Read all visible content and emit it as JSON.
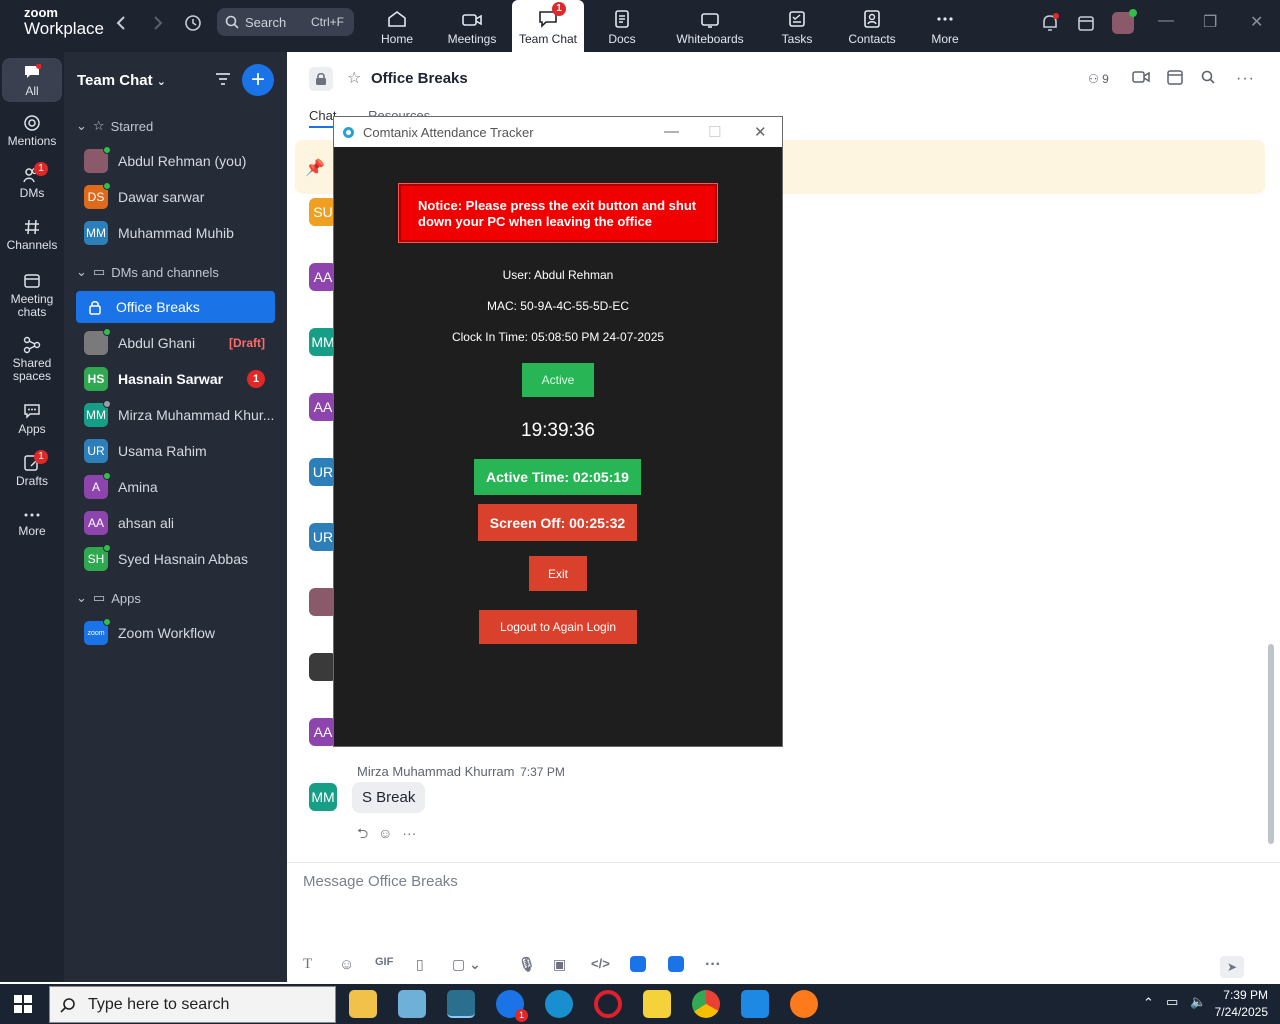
{
  "app": {
    "logo_top": "zoom",
    "logo_bottom": "Workplace"
  },
  "search": {
    "label": "Search",
    "shortcut": "Ctrl+F"
  },
  "nav_tabs": [
    {
      "label": "Home"
    },
    {
      "label": "Meetings"
    },
    {
      "label": "Team Chat",
      "badge": "1"
    },
    {
      "label": "Docs"
    },
    {
      "label": "Whiteboards"
    },
    {
      "label": "Tasks"
    },
    {
      "label": "Contacts"
    },
    {
      "label": "More"
    }
  ],
  "rail": [
    {
      "label": "All"
    },
    {
      "label": "Mentions"
    },
    {
      "label": "DMs",
      "badge": "1"
    },
    {
      "label": "Channels"
    },
    {
      "label": "Meeting chats"
    },
    {
      "label": "Shared spaces"
    },
    {
      "label": "Apps"
    },
    {
      "label": "Drafts",
      "badge": "1"
    },
    {
      "label": "More"
    }
  ],
  "sidebar": {
    "title": "Team Chat",
    "sections": {
      "starred": "Starred",
      "dms": "DMs and channels",
      "apps": "Apps"
    },
    "starred": [
      {
        "initials": "",
        "name": "Abdul Rehman (you)",
        "color": "#8a5a6a"
      },
      {
        "initials": "DS",
        "name": "Dawar sarwar",
        "color": "#e06a1b"
      },
      {
        "initials": "MM",
        "name": "Muhammad Muhib",
        "color": "#2c7fb8"
      }
    ],
    "dms": [
      {
        "initials": "",
        "name": "Office Breaks",
        "selected": true,
        "color": ""
      },
      {
        "initials": "",
        "name": "Abdul Ghani",
        "draft": "[Draft]",
        "color": "#7a7a7a"
      },
      {
        "initials": "HS",
        "name": "Hasnain Sarwar",
        "badge": "1",
        "color": "#2fa84f"
      },
      {
        "initials": "MM",
        "name": "Mirza Muhammad Khur...",
        "color": "#169e86"
      },
      {
        "initials": "UR",
        "name": "Usama Rahim",
        "color": "#2c7fb8"
      },
      {
        "initials": "A",
        "name": "Amina",
        "color": "#8e44ad"
      },
      {
        "initials": "AA",
        "name": "ahsan ali",
        "color": "#8e44ad"
      },
      {
        "initials": "SH",
        "name": "Syed Hasnain Abbas",
        "color": "#2fa84f"
      }
    ],
    "apps": [
      {
        "initials": "zoom",
        "name": "Zoom Workflow",
        "color": "#1b73e8"
      }
    ]
  },
  "channel": {
    "title": "Office Breaks",
    "members": "9",
    "tabs": [
      "Chat",
      "Resources"
    ],
    "avatars": [
      {
        "initials": "SU",
        "color": "#f0a020"
      },
      {
        "initials": "AA",
        "color": "#8e44ad"
      },
      {
        "initials": "MM",
        "color": "#169e86"
      },
      {
        "initials": "AA",
        "color": "#8e44ad"
      },
      {
        "initials": "UR",
        "color": "#2c7fb8"
      },
      {
        "initials": "UR",
        "color": "#2c7fb8"
      },
      {
        "initials": "",
        "color": "#8a5a6a"
      },
      {
        "initials": "",
        "color": "#3a3a3a"
      },
      {
        "initials": "AA",
        "color": "#8e44ad"
      },
      {
        "initials": "MM",
        "color": "#169e86"
      }
    ],
    "last_message": {
      "author": "Mirza Muhammad Khurram",
      "time": "7:37 PM",
      "text": "S Break"
    },
    "compose_placeholder": "Message Office Breaks",
    "toolbar_gif": "GIF"
  },
  "tracker": {
    "window_title": "Comtanix Attendance Tracker",
    "notice": "Notice: Please press the exit button and shut down your PC when leaving the office",
    "user": "User: Abdul Rehman",
    "mac": "MAC: 50-9A-4C-55-5D-EC",
    "clock_in": "Clock In Time: 05:08:50 PM 24-07-2025",
    "status": "Active",
    "current_time": "19:39:36",
    "active_time": "Active Time: 02:05:19",
    "screen_off": "Screen Off: 00:25:32",
    "exit_label": "Exit",
    "logout_label": "Logout to Again Login",
    "colors": {
      "notice": "#f00000",
      "green": "#27b555",
      "red": "#d9412c"
    }
  },
  "taskbar": {
    "search_placeholder": "Type here to search",
    "time": "7:39 PM",
    "date": "7/24/2025",
    "zoom_badge": "1"
  }
}
